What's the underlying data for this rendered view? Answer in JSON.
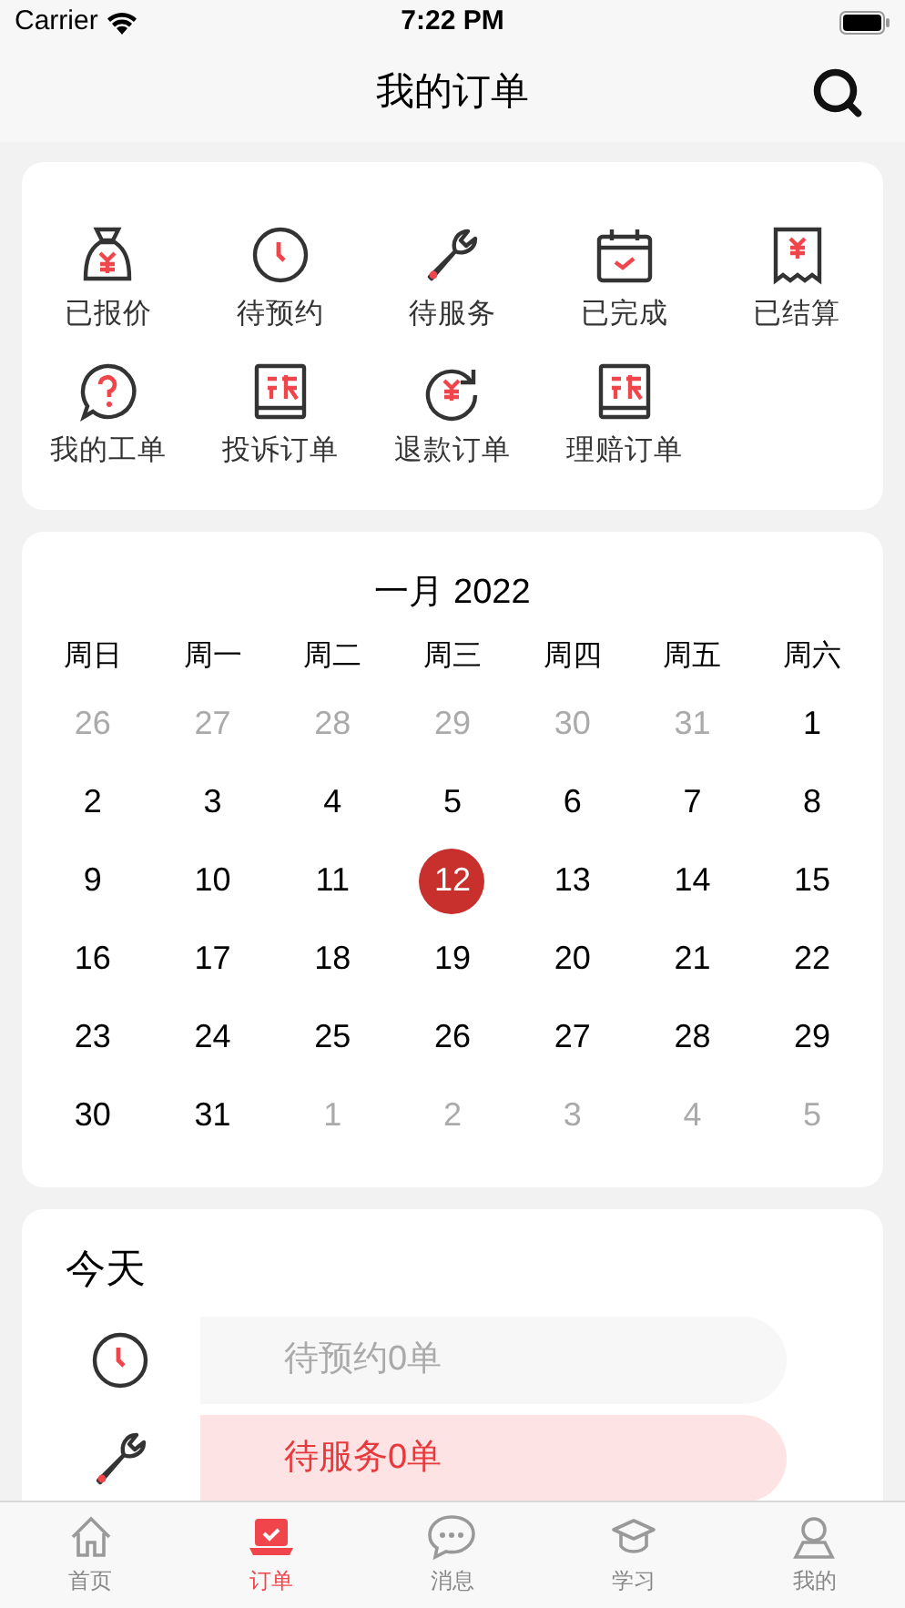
{
  "status_bar": {
    "carrier": "Carrier",
    "time": "7:22 PM"
  },
  "header": {
    "title": "我的订单"
  },
  "order_actions": [
    {
      "label": "已报价"
    },
    {
      "label": "待预约"
    },
    {
      "label": "待服务"
    },
    {
      "label": "已完成"
    },
    {
      "label": "已结算"
    },
    {
      "label": "我的工单"
    },
    {
      "label": "投诉订单"
    },
    {
      "label": "退款订单"
    },
    {
      "label": "理赔订单"
    }
  ],
  "calendar": {
    "month": "一月 2022",
    "weekdays": [
      "周日",
      "周一",
      "周二",
      "周三",
      "周四",
      "周五",
      "周六"
    ],
    "days": [
      {
        "label": "26",
        "muted": true,
        "selected": false
      },
      {
        "label": "27",
        "muted": true,
        "selected": false
      },
      {
        "label": "28",
        "muted": true,
        "selected": false
      },
      {
        "label": "29",
        "muted": true,
        "selected": false
      },
      {
        "label": "30",
        "muted": true,
        "selected": false
      },
      {
        "label": "31",
        "muted": true,
        "selected": false
      },
      {
        "label": "1",
        "muted": false,
        "selected": false
      },
      {
        "label": "2",
        "muted": false,
        "selected": false
      },
      {
        "label": "3",
        "muted": false,
        "selected": false
      },
      {
        "label": "4",
        "muted": false,
        "selected": false
      },
      {
        "label": "5",
        "muted": false,
        "selected": false
      },
      {
        "label": "6",
        "muted": false,
        "selected": false
      },
      {
        "label": "7",
        "muted": false,
        "selected": false
      },
      {
        "label": "8",
        "muted": false,
        "selected": false
      },
      {
        "label": "9",
        "muted": false,
        "selected": false
      },
      {
        "label": "10",
        "muted": false,
        "selected": false
      },
      {
        "label": "11",
        "muted": false,
        "selected": false
      },
      {
        "label": "12",
        "muted": false,
        "selected": true
      },
      {
        "label": "13",
        "muted": false,
        "selected": false
      },
      {
        "label": "14",
        "muted": false,
        "selected": false
      },
      {
        "label": "15",
        "muted": false,
        "selected": false
      },
      {
        "label": "16",
        "muted": false,
        "selected": false
      },
      {
        "label": "17",
        "muted": false,
        "selected": false
      },
      {
        "label": "18",
        "muted": false,
        "selected": false
      },
      {
        "label": "19",
        "muted": false,
        "selected": false
      },
      {
        "label": "20",
        "muted": false,
        "selected": false
      },
      {
        "label": "21",
        "muted": false,
        "selected": false
      },
      {
        "label": "22",
        "muted": false,
        "selected": false
      },
      {
        "label": "23",
        "muted": false,
        "selected": false
      },
      {
        "label": "24",
        "muted": false,
        "selected": false
      },
      {
        "label": "25",
        "muted": false,
        "selected": false
      },
      {
        "label": "26",
        "muted": false,
        "selected": false
      },
      {
        "label": "27",
        "muted": false,
        "selected": false
      },
      {
        "label": "28",
        "muted": false,
        "selected": false
      },
      {
        "label": "29",
        "muted": false,
        "selected": false
      },
      {
        "label": "30",
        "muted": false,
        "selected": false
      },
      {
        "label": "31",
        "muted": false,
        "selected": false
      },
      {
        "label": "1",
        "muted": true,
        "selected": false
      },
      {
        "label": "2",
        "muted": true,
        "selected": false
      },
      {
        "label": "3",
        "muted": true,
        "selected": false
      },
      {
        "label": "4",
        "muted": true,
        "selected": false
      },
      {
        "label": "5",
        "muted": true,
        "selected": false
      }
    ]
  },
  "today": {
    "title": "今天",
    "rows": [
      {
        "label": "待预约0单",
        "highlighted": false
      },
      {
        "label": "待服务0单",
        "highlighted": true
      }
    ]
  },
  "tab_bar": [
    {
      "label": "首页",
      "selected": false
    },
    {
      "label": "订单",
      "selected": true
    },
    {
      "label": "消息",
      "selected": false
    },
    {
      "label": "学习",
      "selected": false
    },
    {
      "label": "我的",
      "selected": false
    }
  ]
}
